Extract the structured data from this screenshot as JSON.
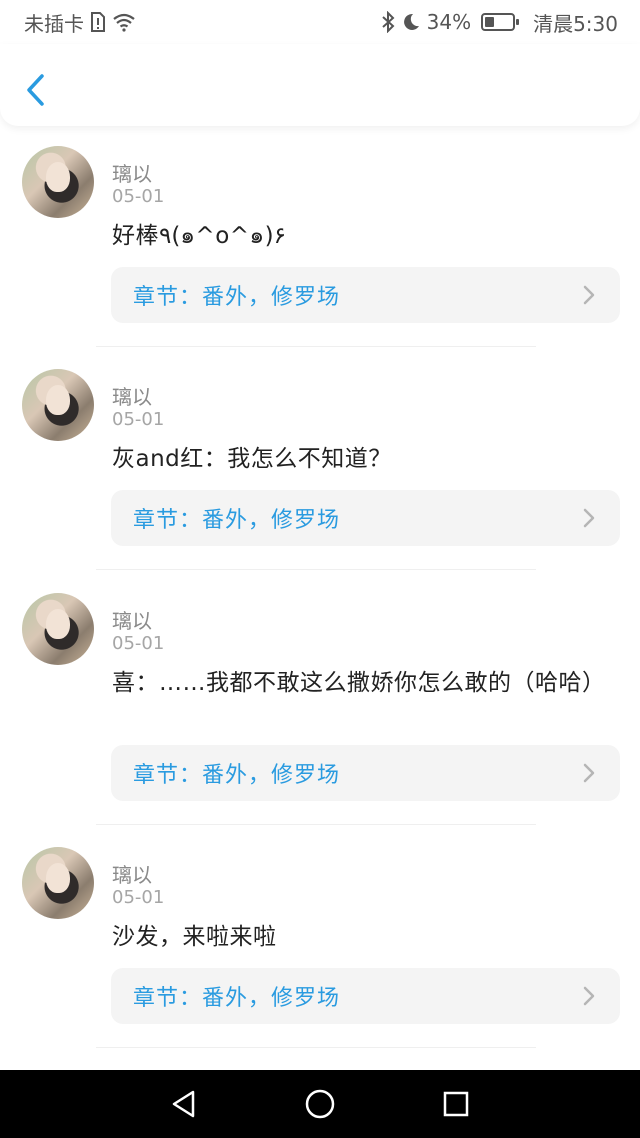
{
  "status_bar": {
    "carrier": "未插卡",
    "battery_percent_text": "34%",
    "battery_level": 0.34,
    "time": "清晨5:30"
  },
  "header": {
    "back_icon": "chevron-left-icon"
  },
  "colors": {
    "accent": "#2a9be0",
    "chapter_bg": "#f4f4f4",
    "text": "#222222",
    "muted": "#8a8a8a"
  },
  "comments": [
    {
      "username": "璃以",
      "date": "05-01",
      "text": "好棒٩(๑^o^๑)۶",
      "chapter": "章节：番外，修罗场"
    },
    {
      "username": "璃以",
      "date": "05-01",
      "text": "灰and红：我怎么不知道？",
      "chapter": "章节：番外，修罗场"
    },
    {
      "username": "璃以",
      "date": "05-01",
      "text": "喜：……我都不敢这么撒娇你怎么敢的（哈哈）",
      "chapter": "章节：番外，修罗场"
    },
    {
      "username": "璃以",
      "date": "05-01",
      "text": "沙发，来啦来啦",
      "chapter": "章节：番外，修罗场"
    }
  ],
  "nav_bar": {
    "back_icon": "triangle-back-icon",
    "home_icon": "circle-home-icon",
    "recents_icon": "square-recents-icon"
  }
}
